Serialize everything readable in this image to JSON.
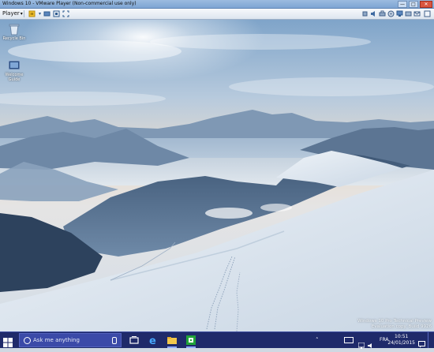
{
  "window": {
    "title": "Windows 10 - VMware Player (Non-commercial use only)",
    "controls": [
      "—",
      "□",
      "✕"
    ]
  },
  "toolbar": {
    "menu_label": "Player",
    "icons": [
      "pause-icon",
      "send-ctrl-alt-del-icon",
      "unity-icon",
      "fullscreen-icon",
      "usb-icon",
      "sound-icon",
      "printer-icon",
      "disk-icon",
      "network-icon",
      "hdd-icon",
      "message-icon"
    ]
  },
  "desktop": {
    "icons": [
      {
        "label": "Recycle Bin",
        "icon": "recycle-bin-icon"
      },
      {
        "label": "Welcome Guide",
        "icon": "shortcut-icon"
      }
    ],
    "watermark": [
      "Windows 10 Pro Technical Preview",
      "Evaluation copy. Build 9926"
    ]
  },
  "taskbar": {
    "search_placeholder": "Ask me anything",
    "apps": [
      "task-view-icon",
      "edge-icon",
      "file-explorer-icon",
      "store-icon"
    ],
    "tray": {
      "language": "FRA",
      "time": "10:51",
      "date": "24/01/2015"
    }
  },
  "colors": {
    "taskbar": "#1f2a6a",
    "search_box": "#3b4aa8",
    "titlebar": "#8fb2dc"
  }
}
